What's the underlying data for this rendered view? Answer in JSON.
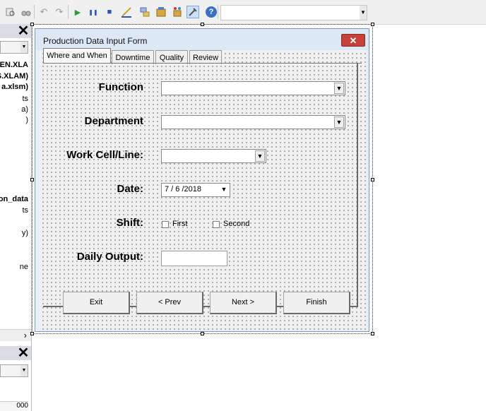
{
  "toolbar": {
    "icons": [
      "find-icon",
      "binoculars-icon",
      "undo-icon",
      "redo-icon",
      "run-icon",
      "break-icon",
      "reset-icon",
      "design-mode-icon",
      "project-explorer-icon",
      "properties-icon",
      "object-browser-icon",
      "toolbox-icon",
      "help-icon"
    ],
    "glyphs": {
      "undo": "↶",
      "redo": "↷",
      "run": "▶",
      "break": "❚❚",
      "reset": "■",
      "help": "?"
    },
    "colors": {
      "run": "#2a9c3a",
      "reset": "#2f56b5",
      "help": "#3b6fc5"
    }
  },
  "left_panel": {
    "close_glyph": "✕",
    "items": [
      {
        "text": "AEN.XLA",
        "bold": true
      },
      {
        "text": "S.XLAM)",
        "bold": true
      },
      {
        "text": "a.xlsm)",
        "bold": true
      },
      {
        "text": "ts",
        "bold": false
      },
      {
        "text": "a)",
        "bold": false
      },
      {
        "text": ")",
        "bold": false
      },
      {
        "text": "on_data",
        "bold": true
      },
      {
        "text": "ts",
        "bold": false
      },
      {
        "text": "y)",
        "bold": false
      },
      {
        "text": "ne",
        "bold": false
      }
    ],
    "scroll_arrow": "›",
    "bottom_value": "000"
  },
  "form": {
    "title": "Production Data Input Form",
    "close_glyph": "✕",
    "tabs": [
      "Where and When",
      "Downtime",
      "Quality",
      "Review"
    ],
    "active_tab": "Where and When",
    "fields": {
      "function_label": "Function",
      "department_label": "Department",
      "workcell_label": "Work Cell/Line:",
      "date_label": "Date:",
      "date_value": "7 / 6 /2018",
      "shift_label": "Shift:",
      "shift_first": "First",
      "shift_second": "Second",
      "daily_output_label": "Daily Output:",
      "daily_output_value": ""
    },
    "buttons": {
      "exit": "Exit",
      "prev": "< Prev",
      "next": "Next >",
      "finish": "Finish"
    }
  }
}
